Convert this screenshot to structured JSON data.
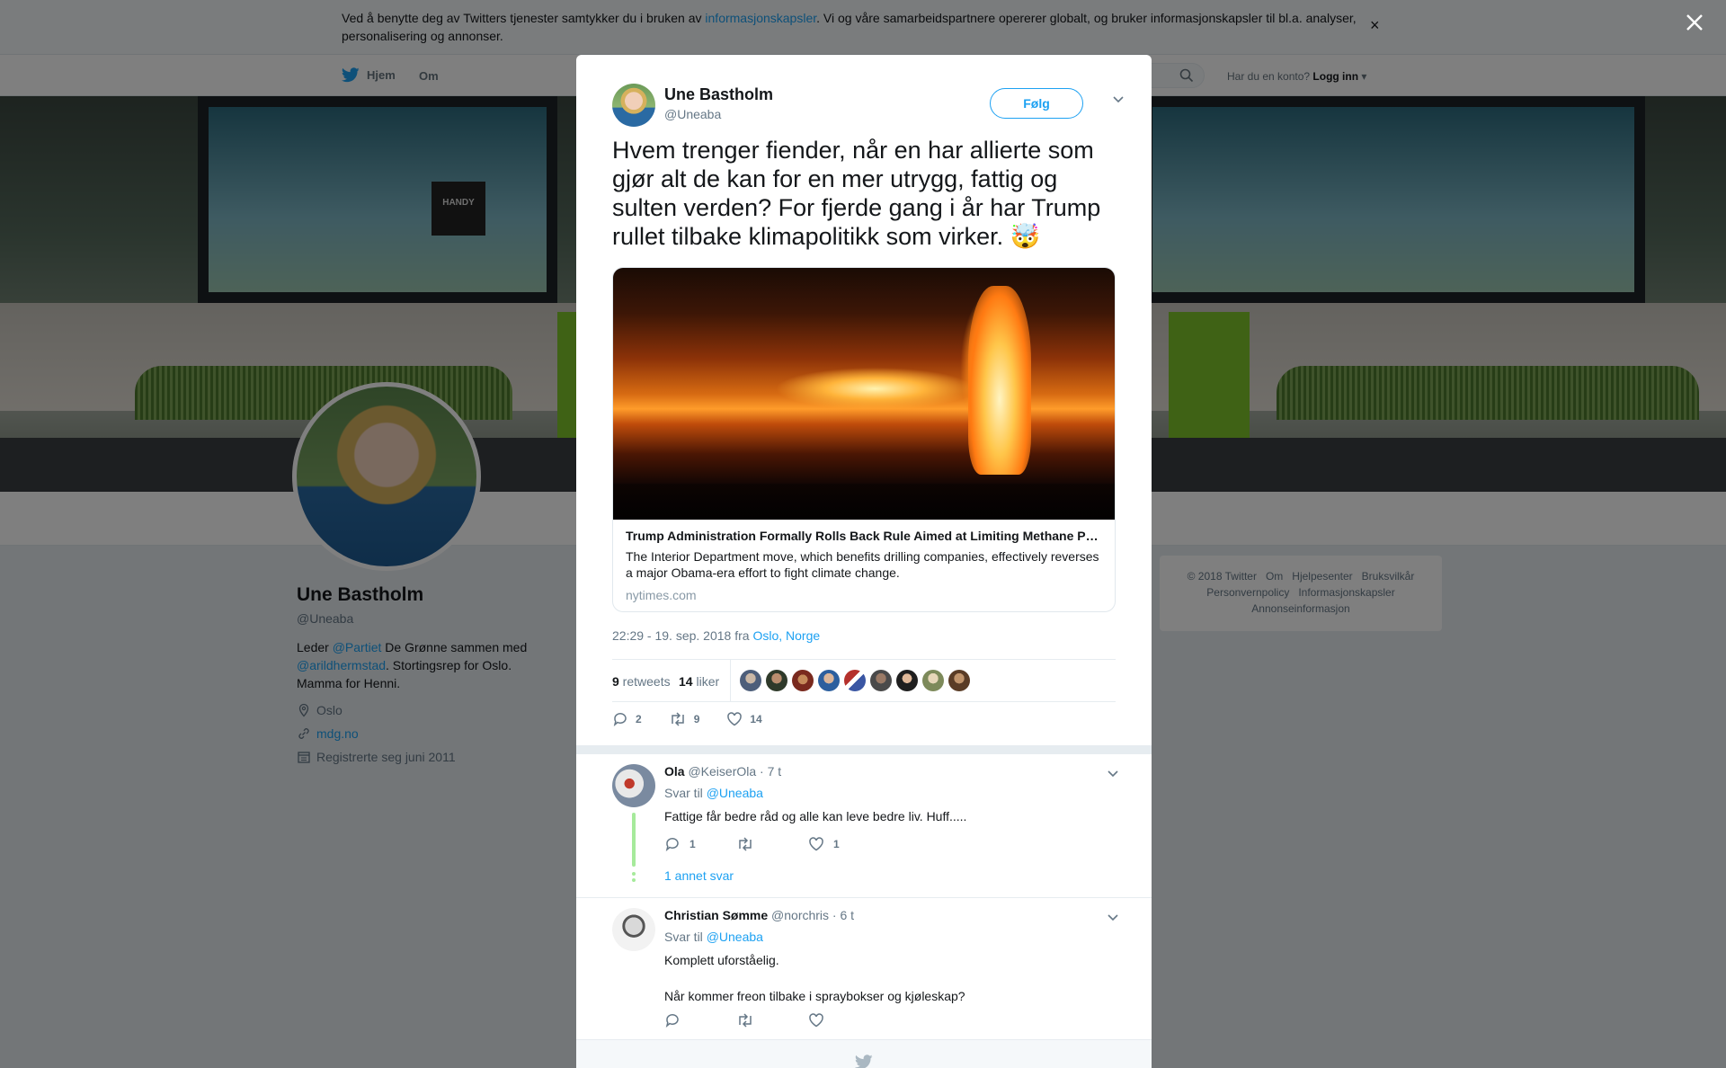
{
  "cookie_banner": {
    "text_before": "Ved å benytte deg av Twitters tjenester samtykker du i bruken av ",
    "link": "informasjonskapsler",
    "text_after": ". Vi og våre samarbeidspartnere opererer globalt, og bruker informasjonskapsler til bl.a. analyser, personalisering og annonser.",
    "close": "×"
  },
  "nav": {
    "home": "Hjem",
    "about": "Om",
    "account_prompt": "Har du en konto?",
    "login": "Logg inn"
  },
  "profile": {
    "name": "Une Bastholm",
    "handle": "@Uneaba",
    "bio_1": "Leder ",
    "bio_mention_1": "@Partiet",
    "bio_2": " De Grønne sammen med ",
    "bio_mention_2": "@arildhermstad",
    "bio_3": ". Stortingsrep for Oslo. Mamma for Henni.",
    "location": "Oslo",
    "website": "mdg.no",
    "joined": "Registrerte seg juni 2011"
  },
  "footer_links": [
    "© 2018 Twitter",
    "Om",
    "Hjelpesenter",
    "Bruksvilkår",
    "Personvernpolicy",
    "Informasjonskapsler",
    "Annonseinformasjon"
  ],
  "tweet": {
    "author_name": "Une Bastholm",
    "author_handle": "@Uneaba",
    "follow_label": "Følg",
    "text": "Hvem trenger fiender, når en har allierte som gjør alt de kan for en mer utrygg, fattig og sulten verden? For fjerde gang i år har Trump rullet tilbake klimapolitikk som virker. 🤯",
    "card": {
      "title": "Trump Administration Formally Rolls Back Rule Aimed at Limiting Methane Pollution",
      "description": "The Interior Department move, which benefits drilling companies, effectively reverses a major Obama-era effort to fight climate change.",
      "domain": "nytimes.com"
    },
    "timestamp": "22:29 - 19. sep. 2018 fra ",
    "place": "Oslo, Norge",
    "retweets_count": "9",
    "retweets_label": " retweets",
    "likes_count": "14",
    "likes_label": " liker",
    "actions": {
      "replies": "2",
      "retweets": "9",
      "likes": "14"
    }
  },
  "replies": [
    {
      "name": "Ola",
      "handle": "@KeiserOla",
      "time": " · 7 t",
      "reply_to_label": "Svar til ",
      "reply_to": "@Uneaba",
      "text": "Fattige får bedre råd og alle kan leve bedre liv. Huff.....",
      "replies": "1",
      "retweets": "",
      "likes": "1",
      "more_replies": "1 annet svar"
    },
    {
      "name": "Christian Sømme",
      "handle": "@norchris",
      "time": " · 6 t",
      "reply_to_label": "Svar til ",
      "reply_to": "@Uneaba",
      "text_1": "Komplett uforståelig.",
      "text_2": "Når kommer freon tilbake i spraybokser og kjøleskap?",
      "replies": "",
      "retweets": "",
      "likes": ""
    }
  ],
  "colors": {
    "accent": "#1da1f2",
    "thread": "#a6ea9b",
    "text": "#14171a",
    "muted": "#657786"
  }
}
